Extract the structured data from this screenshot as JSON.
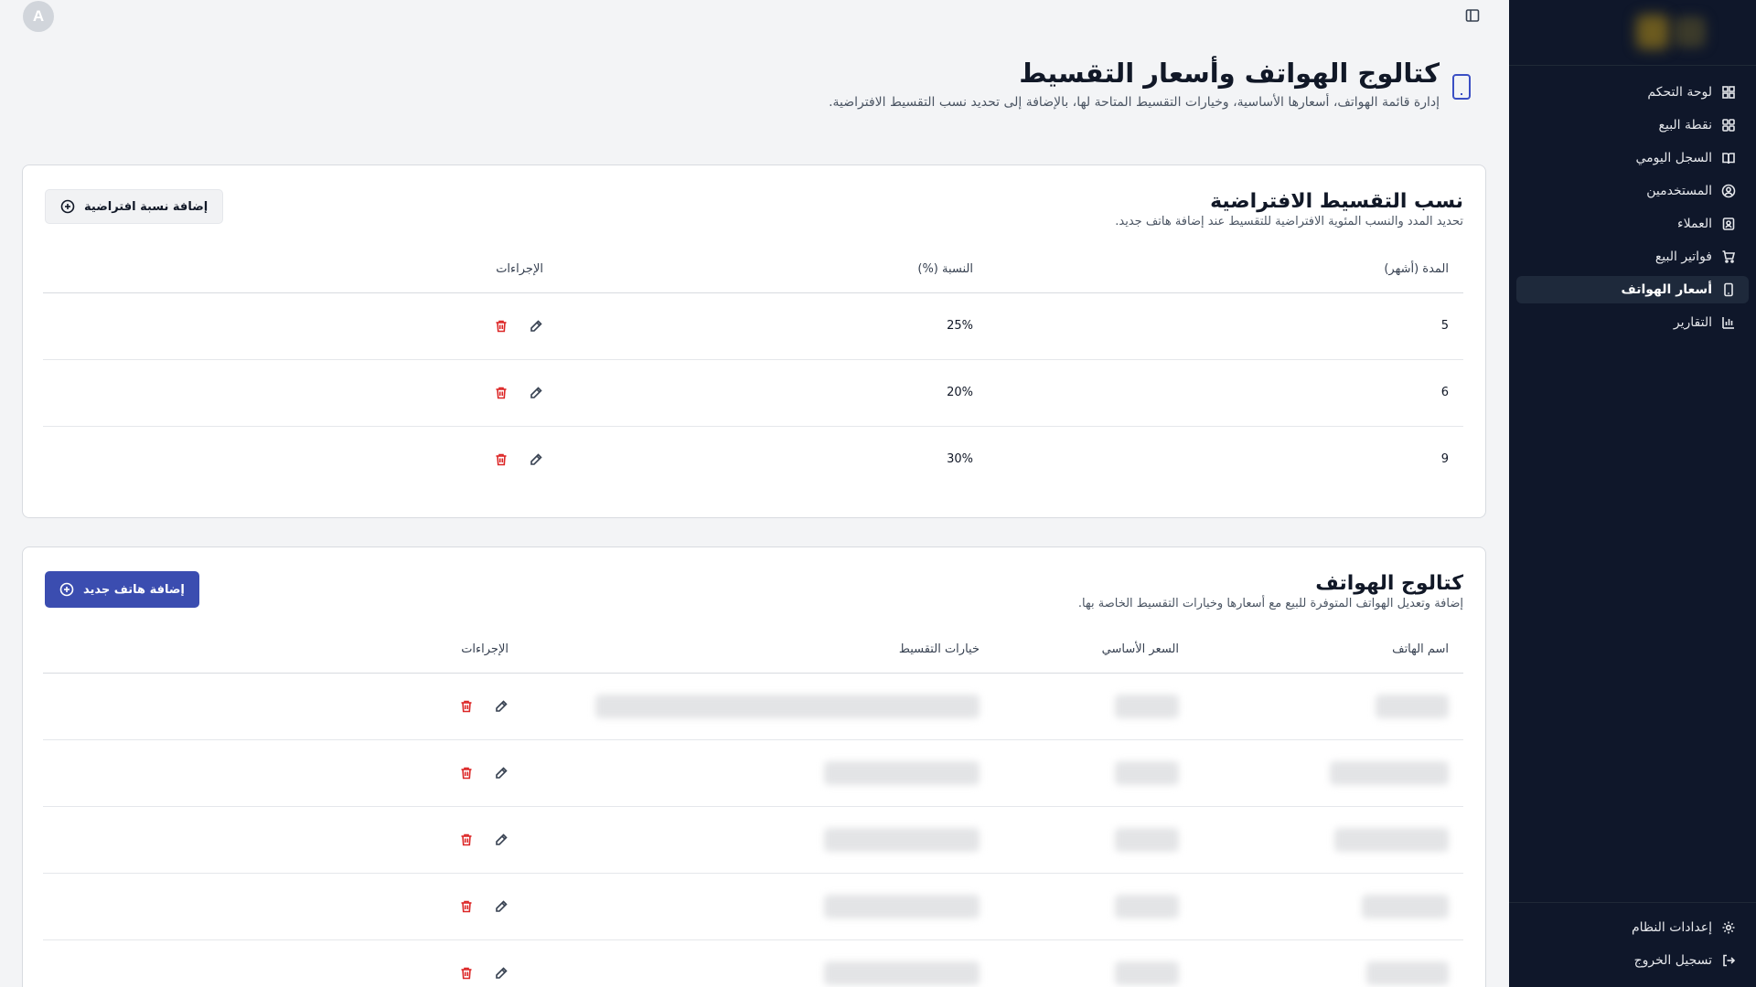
{
  "topbar": {
    "avatar_letter": "A"
  },
  "sidebar": {
    "items": [
      {
        "label": "لوحة التحكم",
        "icon": "dashboard-icon"
      },
      {
        "label": "نقطة البيع",
        "icon": "grid-icon"
      },
      {
        "label": "السجل اليومي",
        "icon": "book-icon"
      },
      {
        "label": "المستخدمين",
        "icon": "user-circle-icon"
      },
      {
        "label": "العملاء",
        "icon": "contact-icon"
      },
      {
        "label": "فواتير البيع",
        "icon": "cart-icon"
      },
      {
        "label": "أسعار الهواتف",
        "icon": "phone-icon",
        "active": true
      },
      {
        "label": "التقارير",
        "icon": "bar-chart-icon"
      }
    ],
    "bottom": [
      {
        "label": "إعدادات النظام",
        "icon": "gear-icon"
      },
      {
        "label": "تسجيل الخروج",
        "icon": "logout-icon"
      }
    ]
  },
  "page": {
    "title": "كتالوج الهواتف وأسعار التقسيط",
    "subtitle": "إدارة قائمة الهواتف، أسعارها الأساسية، وخيارات التقسيط المتاحة لها، بالإضافة إلى تحديد نسب التقسيط الافتراضية."
  },
  "rates": {
    "title": "نسب التقسيط الافتراضية",
    "subtitle": "تحديد المدد والنسب المئوية الافتراضية للتقسيط عند إضافة هاتف جديد.",
    "add_button": "إضافة نسبة افتراضية",
    "columns": [
      "المدة (أشهر)",
      "النسبة (%)",
      "الإجراءات"
    ],
    "rows": [
      {
        "months": "5",
        "rate": "25%"
      },
      {
        "months": "6",
        "rate": "20%"
      },
      {
        "months": "9",
        "rate": "30%"
      }
    ]
  },
  "catalog": {
    "title": "كتالوج الهواتف",
    "subtitle": "إضافة وتعديل الهواتف المتوفرة للبيع مع أسعارها وخيارات التقسيط الخاصة بها.",
    "add_button": "إضافة هاتف جديد",
    "columns": [
      "اسم الهاتف",
      "السعر الأساسي",
      "خيارات التقسيط",
      "الإجراءات"
    ],
    "row_count": 5
  },
  "colors": {
    "sidebar_bg": "#0f172a",
    "primary": "#3b4db0",
    "danger": "#dc2626"
  }
}
